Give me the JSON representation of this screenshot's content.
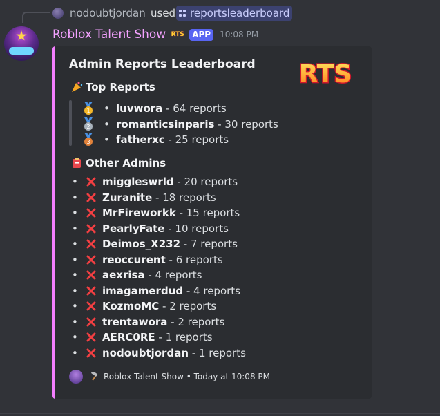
{
  "reply": {
    "username": "nodoubtjordan",
    "used_text": "used",
    "command": "reportsleaderboard"
  },
  "message": {
    "bot_name": "Roblox Talent Show",
    "app_tag": "APP",
    "timestamp": "10:08 PM",
    "badge_text": "RTS"
  },
  "embed": {
    "title": "Admin Reports Leaderboard",
    "accent_color": "#f47fff",
    "thumbnail_text": "RTS",
    "top_heading": "Top Reports",
    "top": [
      {
        "name": "luvwora",
        "count": " - 64 reports",
        "medal": "gold-medal-icon",
        "rank": "1"
      },
      {
        "name": "romanticsinparis",
        "count": " - 30 reports",
        "medal": "silver-medal-icon",
        "rank": "2"
      },
      {
        "name": "fatherxc",
        "count": " - 25 reports",
        "medal": "bronze-medal-icon",
        "rank": "3"
      }
    ],
    "other_heading": "Other Admins",
    "others": [
      {
        "name": "miggleswrld",
        "count": " - 20 reports"
      },
      {
        "name": "Zuranite",
        "count": " - 18 reports"
      },
      {
        "name": "MrFireworkk",
        "count": " - 15 reports"
      },
      {
        "name": "PearlyFate",
        "count": " - 10 reports"
      },
      {
        "name": "Deimos_X232",
        "count": " - 7 reports"
      },
      {
        "name": "reoccurent",
        "count": " - 6 reports"
      },
      {
        "name": "aexrisa",
        "count": " - 4 reports"
      },
      {
        "name": "imagamerdud",
        "count": " - 4 reports"
      },
      {
        "name": "KozmoMC",
        "count": " - 2 reports"
      },
      {
        "name": "trentawora",
        "count": " - 2 reports"
      },
      {
        "name": "AERC0RE",
        "count": " - 1 reports"
      },
      {
        "name": "nodoubtjordan",
        "count": " - 1 reports"
      }
    ],
    "footer": "Roblox Talent Show • Today at 10:08 PM"
  },
  "colors": {
    "bot_name": "#f4a2ff",
    "app_tag": "#5865f2",
    "command_bg": "#3c4270",
    "x_mark": "#f23f42"
  }
}
